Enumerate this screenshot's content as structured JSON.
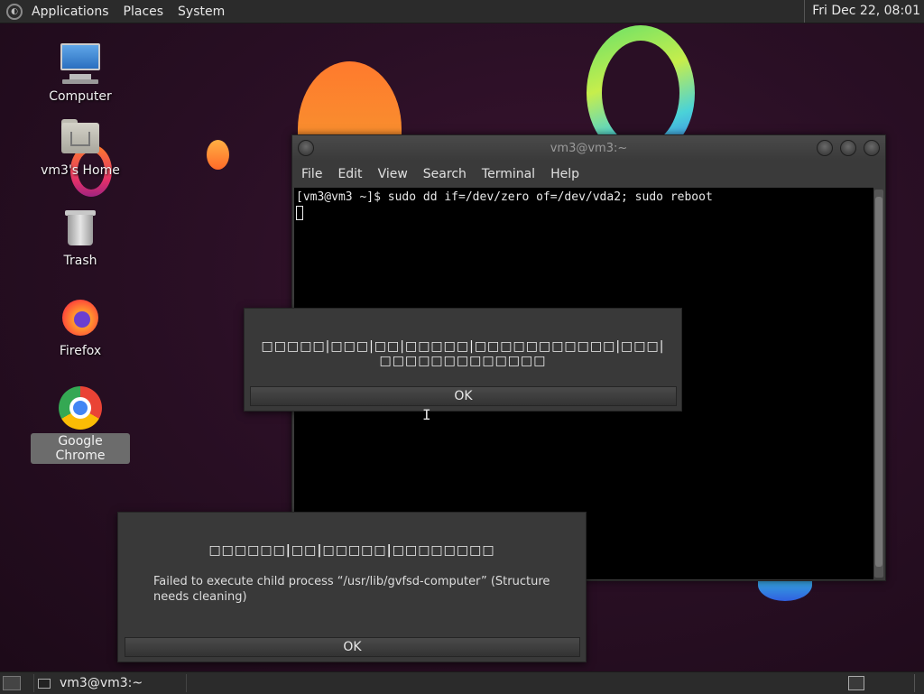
{
  "top_panel": {
    "menus": [
      "Applications",
      "Places",
      "System"
    ],
    "clock": "Fri Dec 22, 08:01"
  },
  "desktop_icons": [
    {
      "label": "Computer",
      "icon": "computer-icon"
    },
    {
      "label": "vm3's Home",
      "icon": "home-folder-icon"
    },
    {
      "label": "Trash",
      "icon": "trash-icon"
    },
    {
      "label": "Firefox",
      "icon": "firefox-icon"
    },
    {
      "label": "Google Chrome",
      "icon": "chrome-icon",
      "selected": true
    }
  ],
  "terminal": {
    "title": "vm3@vm3:~",
    "menu": [
      "File",
      "Edit",
      "View",
      "Search",
      "Terminal",
      "Help"
    ],
    "command_line": "[vm3@vm3 ~]$ sudo dd if=/dev/zero of=/dev/vda2; sudo reboot"
  },
  "dialog_error_1": {
    "message": "□□□□□|□□□|□□|□□□□□|□□□□□□□□□□□|□□□|□□□□□□□□□□□□□",
    "ok_label": "OK"
  },
  "dialog_error_2": {
    "title": "□□□□□□|□□|□□□□□|□□□□□□□□",
    "body": "Failed to execute child process “/usr/lib/gvfsd-computer” (Structure needs cleaning)",
    "ok_label": "OK"
  },
  "bottom_panel": {
    "task_label": "vm3@vm3:~"
  }
}
